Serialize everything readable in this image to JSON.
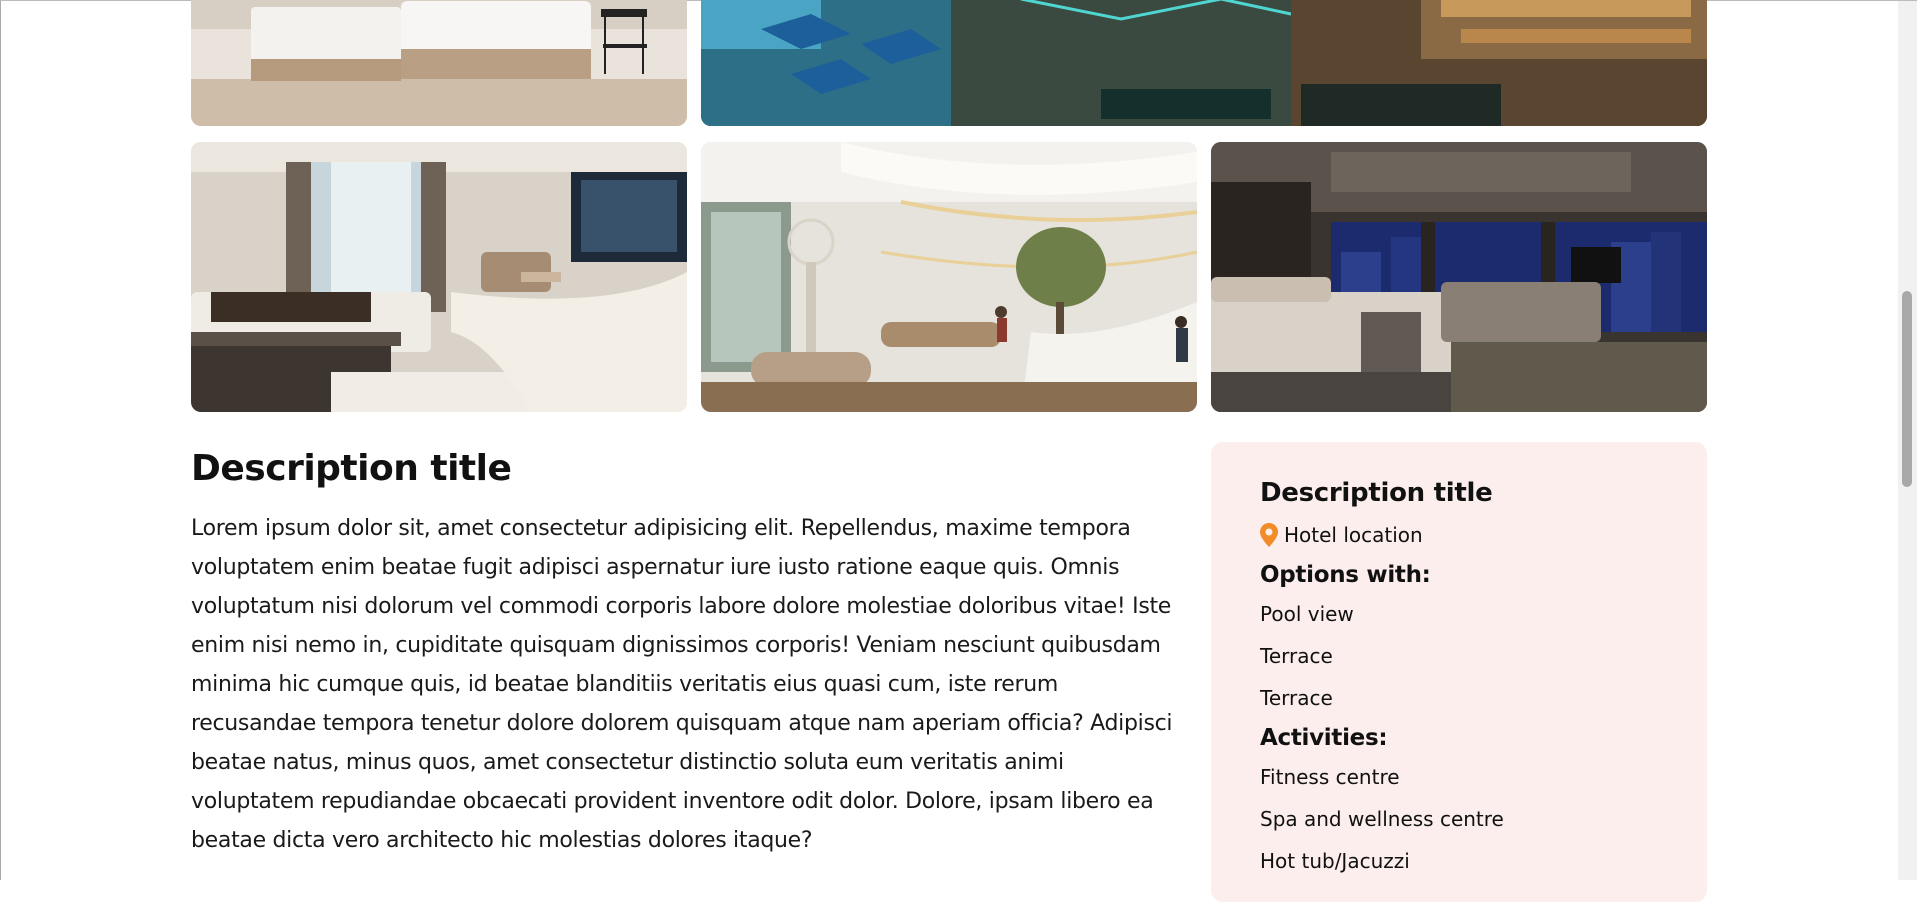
{
  "gallery": {
    "top_row": [
      {
        "alt": "Hotel twin room"
      },
      {
        "alt": "Hotel pool at night"
      }
    ],
    "bottom_row": [
      {
        "alt": "Modern hotel suite"
      },
      {
        "alt": "Hotel lobby"
      },
      {
        "alt": "Hotel room with city view"
      }
    ]
  },
  "description": {
    "title": "Description title",
    "body": "Lorem ipsum dolor sit, amet consectetur adipisicing elit. Repellendus, maxime tempora voluptatem enim beatae fugit adipisci aspernatur iure iusto ratione eaque quis. Omnis voluptatum nisi dolorum vel commodi corporis labore dolore molestiae doloribus vitae! Iste enim nisi nemo in, cupiditate quisquam dignissimos corporis! Veniam nesciunt quibusdam minima hic cumque quis, id beatae blanditiis veritatis eius quasi cum, iste rerum recusandae tempora tenetur dolore dolorem quisquam atque nam aperiam officia? Adipisci beatae natus, minus quos, amet consectetur distinctio soluta eum veritatis animi voluptatem repudiandae obcaecati provident inventore odit dolor. Dolore, ipsam libero ea beatae dicta vero architecto hic molestias dolores itaque?"
  },
  "sidebar": {
    "title": "Description title",
    "location_icon": "map-pin-icon",
    "location": "Hotel location",
    "options_heading": "Options with:",
    "options": [
      "Pool view",
      "Terrace",
      "Terrace"
    ],
    "activities_heading": "Activities:",
    "activities": [
      "Fitness centre",
      "Spa and wellness centre",
      "Hot tub/Jacuzzi"
    ]
  },
  "colors": {
    "sidebar_bg": "#fdeeee",
    "pin": "#f28c28"
  }
}
